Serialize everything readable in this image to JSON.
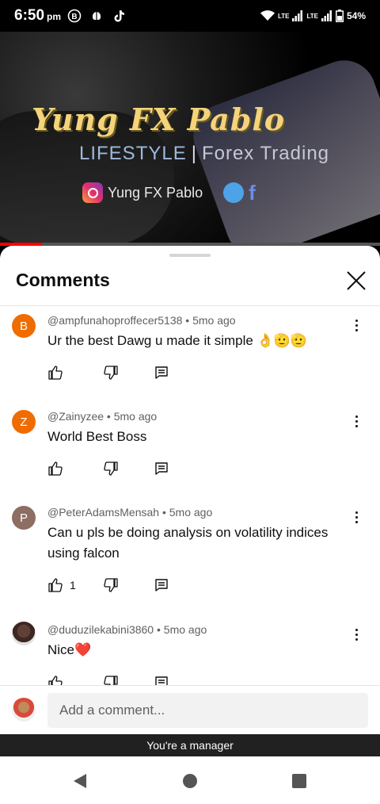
{
  "status": {
    "time": "6:50",
    "ampm": "pm",
    "network_label1": "LTE",
    "network_label2": "LTE",
    "battery": "54%"
  },
  "video": {
    "title": "Yung FX Pablo",
    "subtitle_left": "LIFESTYLE",
    "subtitle_sep": "|",
    "subtitle_right": "Forex Trading",
    "social_handle": "Yung FX Pablo",
    "progress_fraction": 0.11
  },
  "sheet": {
    "title": "Comments"
  },
  "comments": [
    {
      "avatar_letter": "B",
      "avatar_color": "#ef6c00",
      "handle": "@ampfunahoproffecer5138",
      "age": "5mo ago",
      "text": "Ur the best Dawg u made it simple 👌🫡🫡",
      "likes": ""
    },
    {
      "avatar_letter": "Z",
      "avatar_color": "#ef6c00",
      "handle": "@Zainyzee",
      "age": "5mo ago",
      "text": "World Best Boss",
      "likes": ""
    },
    {
      "avatar_letter": "P",
      "avatar_color": "#8d6e63",
      "handle": "@PeterAdamsMensah",
      "age": "5mo ago",
      "text": "Can u pls be doing analysis on volatility indices using falcon",
      "likes": "1"
    },
    {
      "avatar_letter": "",
      "avatar_color": "#4e342e",
      "handle": "@duduzilekabini3860",
      "age": "5mo ago",
      "text": "Nice❤️",
      "likes": ""
    }
  ],
  "add_comment": {
    "placeholder": "Add a comment..."
  },
  "banner": {
    "text": "You're a manager"
  },
  "colors": {
    "accent_red": "#ff0000",
    "meta_gray": "#606060"
  }
}
